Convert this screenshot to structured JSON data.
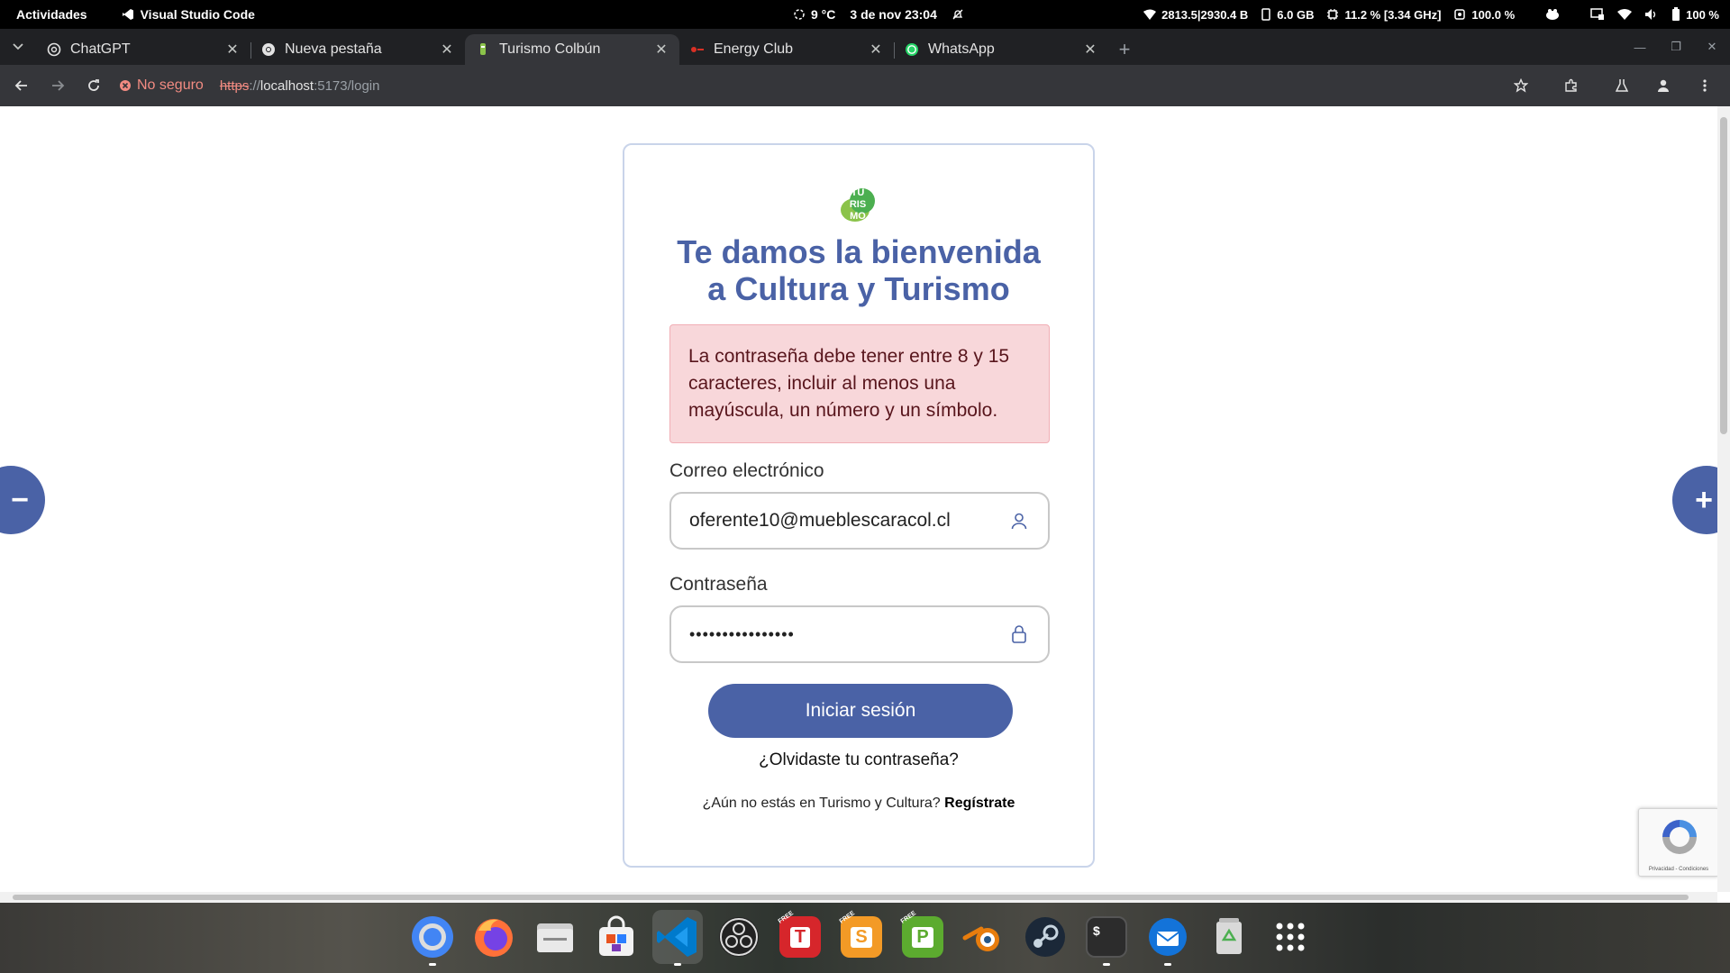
{
  "topbar": {
    "activities": "Actividades",
    "app_name": "Visual Studio Code",
    "weather": "9 °C",
    "datetime": "3 de nov  23:04",
    "network": "2813.5|2930.4 B",
    "memory": "6.0 GB",
    "cpu": "11.2 % [3.34 GHz]",
    "cpu2": "100.0 %",
    "battery": "100 %"
  },
  "tabs": [
    {
      "title": "ChatGPT",
      "icon": "chatgpt-icon",
      "active": false
    },
    {
      "title": "Nueva pestaña",
      "icon": "chrome-icon",
      "active": false
    },
    {
      "title": "Turismo Colbún",
      "icon": "turismo-favicon",
      "active": true
    },
    {
      "title": "Energy Club",
      "icon": "energy-club-icon",
      "active": false
    },
    {
      "title": "WhatsApp",
      "icon": "whatsapp-icon",
      "active": false
    }
  ],
  "toolbar": {
    "security_label": "No seguro",
    "url_scheme": "https",
    "url_sep": "://",
    "url_host": "localhost",
    "url_rest": ":5173/login"
  },
  "login": {
    "logo_text": [
      "TU",
      "RIS",
      "MO"
    ],
    "title_line1": "Te damos la bienvenida",
    "title_line2": "a Cultura y Turismo",
    "alert": "La contraseña debe tener entre 8 y 15 caracteres, incluir al menos una mayúscula, un número y un símbolo.",
    "email_label": "Correo electrónico",
    "email_value": "oferente10@mueblescaracol.cl",
    "password_label": "Contraseña",
    "password_value": "••••••••••••••••",
    "submit": "Iniciar sesión",
    "forgot": "¿Olvidaste tu contraseña?",
    "signup_prompt": "¿Aún no estás en Turismo y Cultura?",
    "signup_link": "Regístrate"
  },
  "page_controls": {
    "zoom_out": "−",
    "zoom_in": "+"
  },
  "recaptcha": {
    "links": "Privacidad - Condiciones"
  },
  "dock": [
    {
      "name": "chrome"
    },
    {
      "name": "firefox"
    },
    {
      "name": "files"
    },
    {
      "name": "software"
    },
    {
      "name": "vscode"
    },
    {
      "name": "obs"
    },
    {
      "name": "textmaker"
    },
    {
      "name": "planmaker"
    },
    {
      "name": "presentations"
    },
    {
      "name": "blender"
    },
    {
      "name": "steam"
    },
    {
      "name": "terminal"
    },
    {
      "name": "thunderbird"
    },
    {
      "name": "trash"
    },
    {
      "name": "app-grid"
    }
  ],
  "dock_labels": {
    "textmaker": "T",
    "planmaker": "S",
    "presentations": "P",
    "terminal": "$",
    "free_badge": "FREE"
  }
}
